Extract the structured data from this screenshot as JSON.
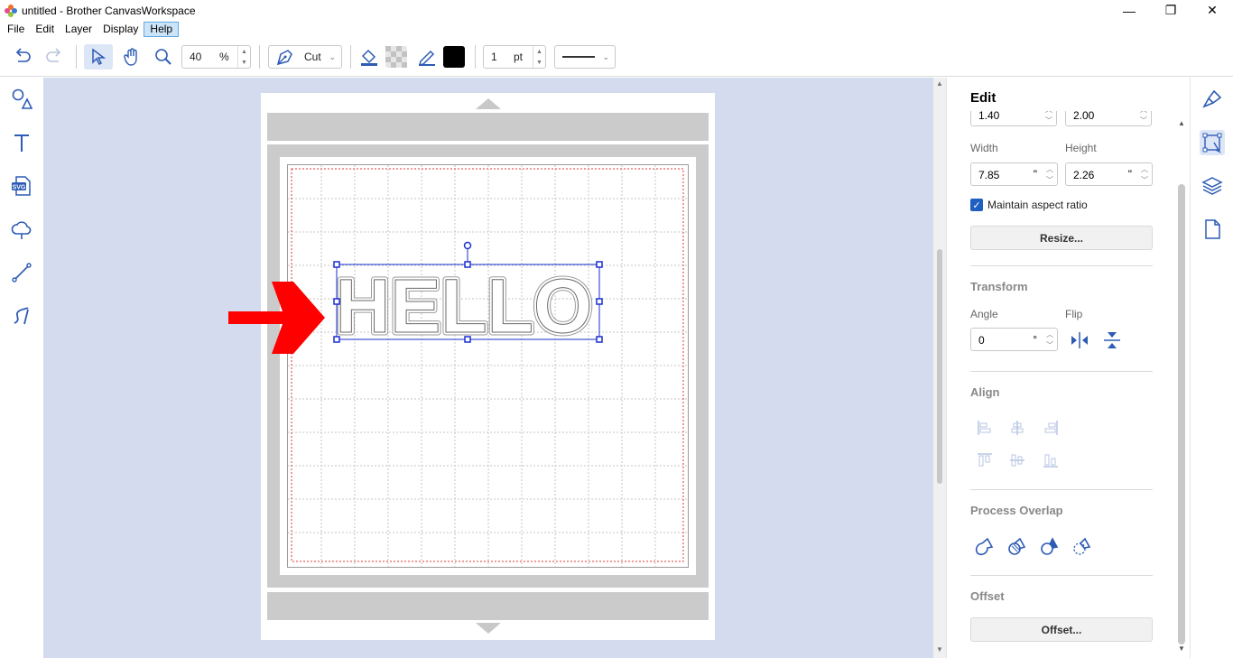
{
  "window": {
    "title": "untitled - Brother CanvasWorkspace",
    "minimize": "—",
    "restore": "❐",
    "close": "✕"
  },
  "menu": [
    {
      "label": "File"
    },
    {
      "label": "Edit"
    },
    {
      "label": "Layer"
    },
    {
      "label": "Display"
    },
    {
      "label": "Help",
      "active": true
    }
  ],
  "toolbar": {
    "zoom_value": "40",
    "zoom_unit": "%",
    "mode_label": "Cut",
    "line_width_value": "1",
    "line_width_unit": "pt",
    "fill_color": "#000000"
  },
  "canvas": {
    "text_object": "HELLO",
    "arrow_color": "#ff0000",
    "selection_color": "#1a2fd1"
  },
  "panel": {
    "title": "Edit",
    "partial_x_value": "1.40",
    "partial_y_value": "2.00",
    "width_label": "Width",
    "height_label": "Height",
    "width_value": "7.85",
    "height_value": "2.26",
    "size_unit": "\"",
    "maintain_aspect_label": "Maintain aspect ratio",
    "maintain_aspect_checked": true,
    "resize_button": "Resize...",
    "transform_heading": "Transform",
    "angle_label": "Angle",
    "flip_label": "Flip",
    "angle_value": "0",
    "angle_unit": "°",
    "align_heading": "Align",
    "process_overlap_heading": "Process Overlap",
    "offset_heading": "Offset",
    "offset_button": "Offset..."
  },
  "colors": {
    "accent": "#1f5fbf",
    "canvas_bg": "#d4dbef",
    "icon_blue": "#2d5bb5"
  }
}
